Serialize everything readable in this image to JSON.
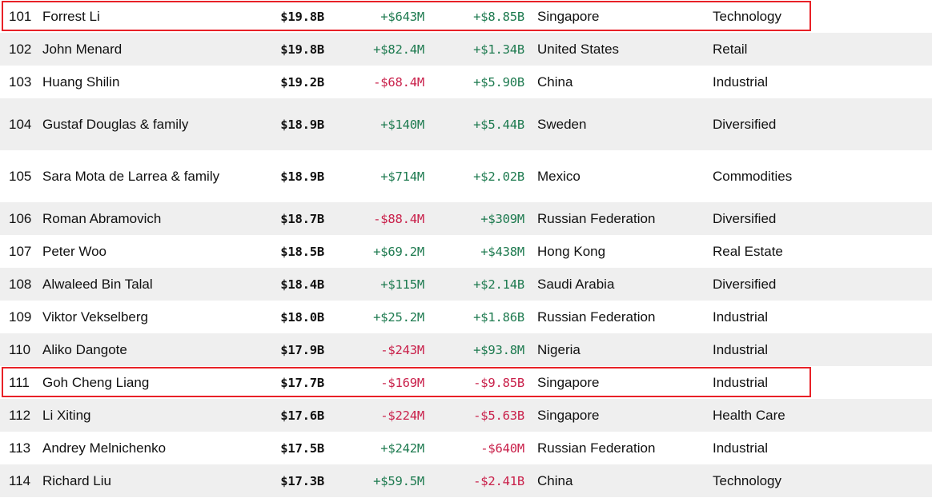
{
  "table": {
    "columns": [
      "rank",
      "name",
      "total_net_worth",
      "last_change",
      "ytd_change",
      "country",
      "industry"
    ],
    "colors": {
      "positive": "#1d7a4f",
      "negative": "#c9204a",
      "highlight_outline": "#e82127",
      "stripe_background": "#efefef",
      "row_background": "#ffffff",
      "text": "#111111"
    },
    "rows": [
      {
        "rank": "101",
        "name": "Forrest Li",
        "value": "$19.8B",
        "change": "+$643M",
        "change_sign": "pos",
        "ytd": "+$8.85B",
        "ytd_sign": "pos",
        "country": "Singapore",
        "industry": "Technology",
        "stripe": false,
        "tall": false,
        "highlight": true
      },
      {
        "rank": "102",
        "name": "John Menard",
        "value": "$19.8B",
        "change": "+$82.4M",
        "change_sign": "pos",
        "ytd": "+$1.34B",
        "ytd_sign": "pos",
        "country": "United States",
        "industry": "Retail",
        "stripe": true,
        "tall": false,
        "highlight": false
      },
      {
        "rank": "103",
        "name": "Huang Shilin",
        "value": "$19.2B",
        "change": "-$68.4M",
        "change_sign": "neg",
        "ytd": "+$5.90B",
        "ytd_sign": "pos",
        "country": "China",
        "industry": "Industrial",
        "stripe": false,
        "tall": false,
        "highlight": false
      },
      {
        "rank": "104",
        "name": "Gustaf Douglas & family",
        "value": "$18.9B",
        "change": "+$140M",
        "change_sign": "pos",
        "ytd": "+$5.44B",
        "ytd_sign": "pos",
        "country": "Sweden",
        "industry": "Diversified",
        "stripe": true,
        "tall": true,
        "highlight": false
      },
      {
        "rank": "105",
        "name": "Sara Mota de Larrea & family",
        "value": "$18.9B",
        "change": "+$714M",
        "change_sign": "pos",
        "ytd": "+$2.02B",
        "ytd_sign": "pos",
        "country": "Mexico",
        "industry": "Commodities",
        "stripe": false,
        "tall": true,
        "highlight": false
      },
      {
        "rank": "106",
        "name": "Roman Abramovich",
        "value": "$18.7B",
        "change": "-$88.4M",
        "change_sign": "neg",
        "ytd": "+$309M",
        "ytd_sign": "pos",
        "country": "Russian Federation",
        "industry": "Diversified",
        "stripe": true,
        "tall": false,
        "highlight": false
      },
      {
        "rank": "107",
        "name": "Peter Woo",
        "value": "$18.5B",
        "change": "+$69.2M",
        "change_sign": "pos",
        "ytd": "+$438M",
        "ytd_sign": "pos",
        "country": "Hong Kong",
        "industry": "Real Estate",
        "stripe": false,
        "tall": false,
        "highlight": false
      },
      {
        "rank": "108",
        "name": "Alwaleed Bin Talal",
        "value": "$18.4B",
        "change": "+$115M",
        "change_sign": "pos",
        "ytd": "+$2.14B",
        "ytd_sign": "pos",
        "country": "Saudi Arabia",
        "industry": "Diversified",
        "stripe": true,
        "tall": false,
        "highlight": false
      },
      {
        "rank": "109",
        "name": "Viktor Vekselberg",
        "value": "$18.0B",
        "change": "+$25.2M",
        "change_sign": "pos",
        "ytd": "+$1.86B",
        "ytd_sign": "pos",
        "country": "Russian Federation",
        "industry": "Industrial",
        "stripe": false,
        "tall": false,
        "highlight": false
      },
      {
        "rank": "110",
        "name": "Aliko Dangote",
        "value": "$17.9B",
        "change": "-$243M",
        "change_sign": "neg",
        "ytd": "+$93.8M",
        "ytd_sign": "pos",
        "country": "Nigeria",
        "industry": "Industrial",
        "stripe": true,
        "tall": false,
        "highlight": false
      },
      {
        "rank": "111",
        "name": "Goh Cheng Liang",
        "value": "$17.7B",
        "change": "-$169M",
        "change_sign": "neg",
        "ytd": "-$9.85B",
        "ytd_sign": "neg",
        "country": "Singapore",
        "industry": "Industrial",
        "stripe": false,
        "tall": false,
        "highlight": true
      },
      {
        "rank": "112",
        "name": "Li Xiting",
        "value": "$17.6B",
        "change": "-$224M",
        "change_sign": "neg",
        "ytd": "-$5.63B",
        "ytd_sign": "neg",
        "country": "Singapore",
        "industry": "Health Care",
        "stripe": true,
        "tall": false,
        "highlight": false
      },
      {
        "rank": "113",
        "name": "Andrey Melnichenko",
        "value": "$17.5B",
        "change": "+$242M",
        "change_sign": "pos",
        "ytd": "-$640M",
        "ytd_sign": "neg",
        "country": "Russian Federation",
        "industry": "Industrial",
        "stripe": false,
        "tall": false,
        "highlight": false
      },
      {
        "rank": "114",
        "name": "Richard Liu",
        "value": "$17.3B",
        "change": "+$59.5M",
        "change_sign": "pos",
        "ytd": "-$2.41B",
        "ytd_sign": "neg",
        "country": "China",
        "industry": "Technology",
        "stripe": true,
        "tall": false,
        "highlight": false
      }
    ]
  }
}
